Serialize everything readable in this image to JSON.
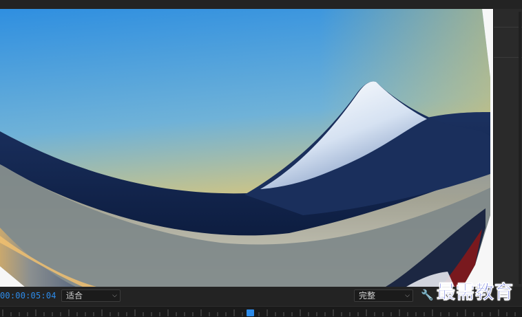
{
  "viewer": {
    "timecode": "00:00:05:04",
    "zoom_select": {
      "value": "适合"
    },
    "quality_select": {
      "value": "完整"
    },
    "settings_icon": "wrench-icon"
  },
  "watermark": {
    "text": "最需教育"
  },
  "timeline": {
    "playhead_progress": 0.48
  },
  "colors": {
    "accent": "#2d8ceb",
    "panel_bg": "#232323",
    "watermark": "#1528c8"
  }
}
